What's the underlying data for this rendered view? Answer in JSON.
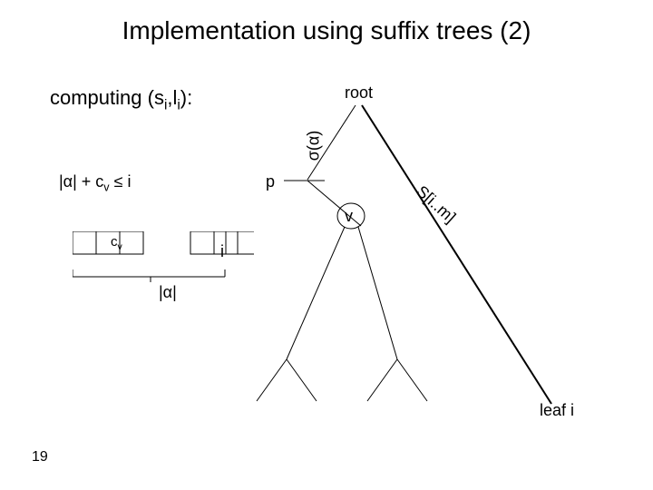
{
  "title": "Implementation using suffix trees (2)",
  "computing": "computing (s<sub>i</sub>,l<sub>i</sub>):",
  "root": "root",
  "condition": "|α| + c<sub>v</sub> ≤ i",
  "alpha_sigma": "σ(α)",
  "p": "p",
  "v": "v",
  "sim": "S[i..m]",
  "cv": "c<sub>v</sub>",
  "i": "i",
  "alpha_len": "|α|",
  "leaf": "leaf i",
  "slide_number": "19"
}
